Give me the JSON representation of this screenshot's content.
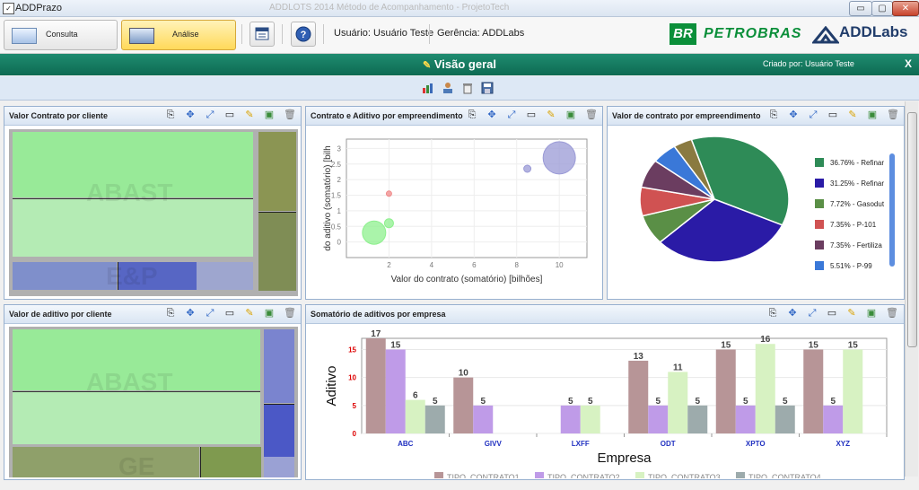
{
  "window": {
    "title": "ADDPrazo",
    "caption": "ADDLOTS 2014 Método de Acompanhamento - ProjetoTech",
    "min": "▭",
    "max": "▢",
    "close": "✕"
  },
  "toolbar": {
    "consulta": "Consulta",
    "analise": "Análise",
    "usuario": "Usuário: Usuário Teste",
    "gerencia": "Gerência: ADDLabs"
  },
  "brand": {
    "br": "BR",
    "petrobras": "PETROBRAS",
    "addlabs": "ADDLabs"
  },
  "header": {
    "title": "Visão geral",
    "pencil": "✎",
    "created_by": "Criado por: Usuário Teste",
    "close": "X"
  },
  "panels": {
    "p1": {
      "title": "Valor Contrato por cliente",
      "labels": [
        "ABAST",
        "E&P"
      ]
    },
    "p2": {
      "title": "Contrato e Aditivo por empreendimento"
    },
    "p3": {
      "title": "Valor de contrato por empreendimento"
    },
    "p4": {
      "title": "Valor de aditivo por cliente",
      "labels": [
        "ABAST",
        "GE"
      ]
    },
    "p5": {
      "title": "Somatório de aditivos por empresa"
    }
  },
  "chart_data": [
    {
      "type": "scatter",
      "xlabel": "Valor do contrato (somatório)   [bilhões]",
      "ylabel": "do aditivo (somatório)   [bilh",
      "xticks": [
        2,
        4,
        6,
        8,
        10
      ],
      "yticks": [
        0,
        0.5,
        1,
        1.5,
        2,
        2.5,
        3
      ],
      "xlim": [
        0,
        11.3
      ],
      "ylim": [
        -0.5,
        3.3
      ],
      "points": [
        {
          "x": 1.3,
          "y": 0.3,
          "r": 13,
          "color": "#8ef08e"
        },
        {
          "x": 2.0,
          "y": 0.6,
          "r": 5,
          "color": "#8ef08e"
        },
        {
          "x": 2.0,
          "y": 1.55,
          "r": 3,
          "color": "#f08a8a"
        },
        {
          "x": 8.5,
          "y": 2.35,
          "r": 4,
          "color": "#9a9ad6"
        },
        {
          "x": 10.0,
          "y": 2.7,
          "r": 18,
          "color": "#9a9ad6"
        }
      ]
    },
    {
      "type": "pie",
      "slices": [
        {
          "label": "36.76% - Refinar",
          "value": 36.76,
          "color": "#2e8b57"
        },
        {
          "label": "31.25% - Refinar",
          "value": 31.25,
          "color": "#2a1ba6"
        },
        {
          "label": "7.72% - Gasodut",
          "value": 7.72,
          "color": "#5a8f46"
        },
        {
          "label": "7.35% - P-101",
          "value": 7.35,
          "color": "#d05252"
        },
        {
          "label": "7.35% - Fertiliza",
          "value": 7.35,
          "color": "#6b3d60"
        },
        {
          "label": "5.51% - P-99",
          "value": 5.51,
          "color": "#3a78d8"
        },
        {
          "label": "",
          "value": 4.06,
          "color": "#8a7a40"
        }
      ]
    },
    {
      "type": "bar",
      "xlabel": "Empresa",
      "ylabel": "Aditivo",
      "yticks": [
        0,
        5,
        10,
        15
      ],
      "ylim": [
        0,
        17
      ],
      "categories": [
        "ABC",
        "GIVV",
        "LXFF",
        "ODT",
        "XPTO",
        "XYZ"
      ],
      "series": [
        {
          "name": "TIPO_CONTRATO1",
          "color": "#b79597",
          "values": [
            17,
            10,
            0,
            13,
            15,
            15
          ]
        },
        {
          "name": "TIPO_CONTRATO2",
          "color": "#bf9be8",
          "values": [
            15,
            5,
            5,
            5,
            5,
            5
          ]
        },
        {
          "name": "TIPO_CONTRATO3",
          "color": "#d7f2c2",
          "values": [
            6,
            0,
            5,
            11,
            16,
            15
          ]
        },
        {
          "name": "TIPO_CONTRATO4",
          "color": "#9dabac",
          "values": [
            5,
            0,
            0,
            5,
            5,
            0
          ]
        }
      ]
    }
  ]
}
